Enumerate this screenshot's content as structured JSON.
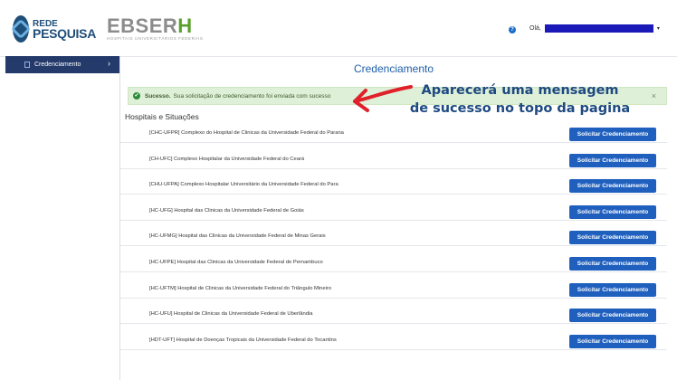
{
  "header": {
    "logo_rede_line1": "REDE",
    "logo_rede_line2": "PESQUISA",
    "logo_ebserh_main": "EBSER",
    "logo_ebserh_h": "H",
    "logo_ebserh_sub": "HOSPITAIS UNIVERSITÁRIOS FEDERAIS",
    "help_icon": "?",
    "user_greeting": "Olá,",
    "caret": "▾"
  },
  "sidebar": {
    "items": [
      {
        "label": "Credenciamento",
        "icon": "document-icon",
        "chevron": "›"
      }
    ]
  },
  "main": {
    "title": "Credenciamento",
    "alert": {
      "strong": "Sucesso.",
      "message": "Sua solicitação de credenciamento foi enviada com sucesso",
      "close": "×",
      "icon": "✔"
    },
    "section_title": "Hospitais e Situações",
    "button_label": "Solicitar Credenciamento",
    "hospitals": [
      "[CHC-UFPR] Complexo do Hospital de Clinicas da Universidade Federal do Parana",
      "[CH-UFC] Complexo Hospitalar da Universidade Federal do Ceará",
      "[CHU-UFPA] Complexo Hospitalar Universitário da Universidade Federal do Para",
      "[HC-UFG] Hospital das Clinicas da Universidade Federal de Goiás",
      "[HC-UFMG] Hospital das Clinicas da Universidade Federal de Minas Gerais",
      "[HC-UFPE] Hospital das Clinicas da Universidade Federal de Pernambuco",
      "[HC-UFTM] Hospital de Clinicas da Universidade Federal do Triângulo Mineiro",
      "[HC-UFU] Hospital de Clinicas da Universidade Federal de Uberlândia",
      "[HDT-UFT] Hospital de Doenças Tropicais da Universidade Federal do Tocantins"
    ]
  },
  "annotation": {
    "line1": "Aparecerá uma mensagem",
    "line2": "de sucesso no topo da pagina",
    "color": "#e0202a"
  }
}
